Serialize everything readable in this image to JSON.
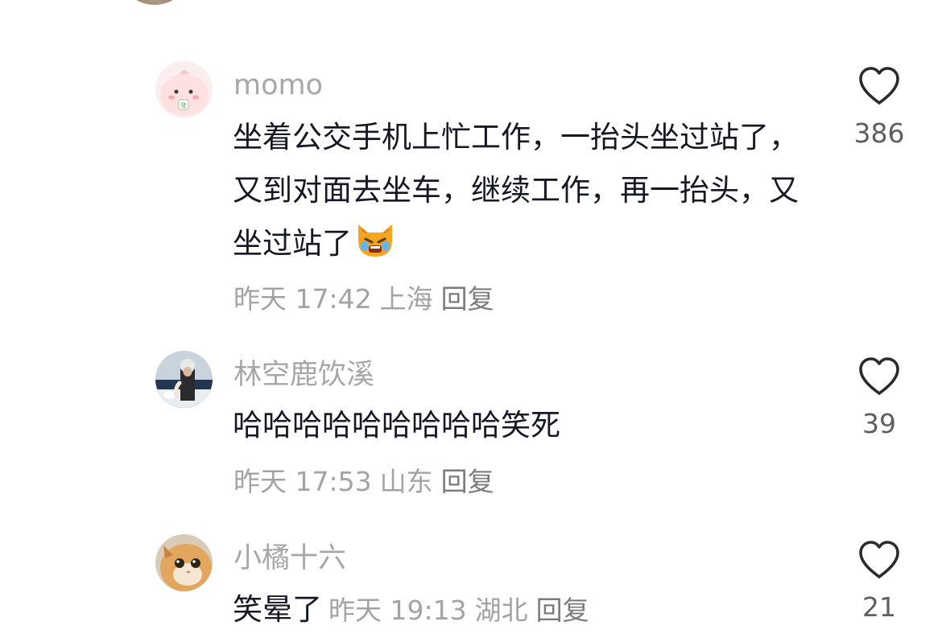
{
  "comments": [
    {
      "username": "momo",
      "content": "坐着公交手机上忙工作，一抬头坐过站了，又到对面去坐车，继续工作，再一抬头，又坐过站了",
      "emoji": "crying-cat-emoji",
      "time": "昨天 17:42",
      "location": "上海",
      "reply_label": "回复",
      "likes": "386"
    },
    {
      "username": "林空鹿饮溪",
      "content": "哈哈哈哈哈哈哈哈哈笑死",
      "time": "昨天 17:53",
      "location": "山东",
      "reply_label": "回复",
      "likes": "39"
    },
    {
      "username": "小橘十六",
      "content": "笑晕了",
      "time": "昨天 19:13",
      "location": "湖北",
      "reply_label": "回复",
      "likes": "21"
    }
  ]
}
